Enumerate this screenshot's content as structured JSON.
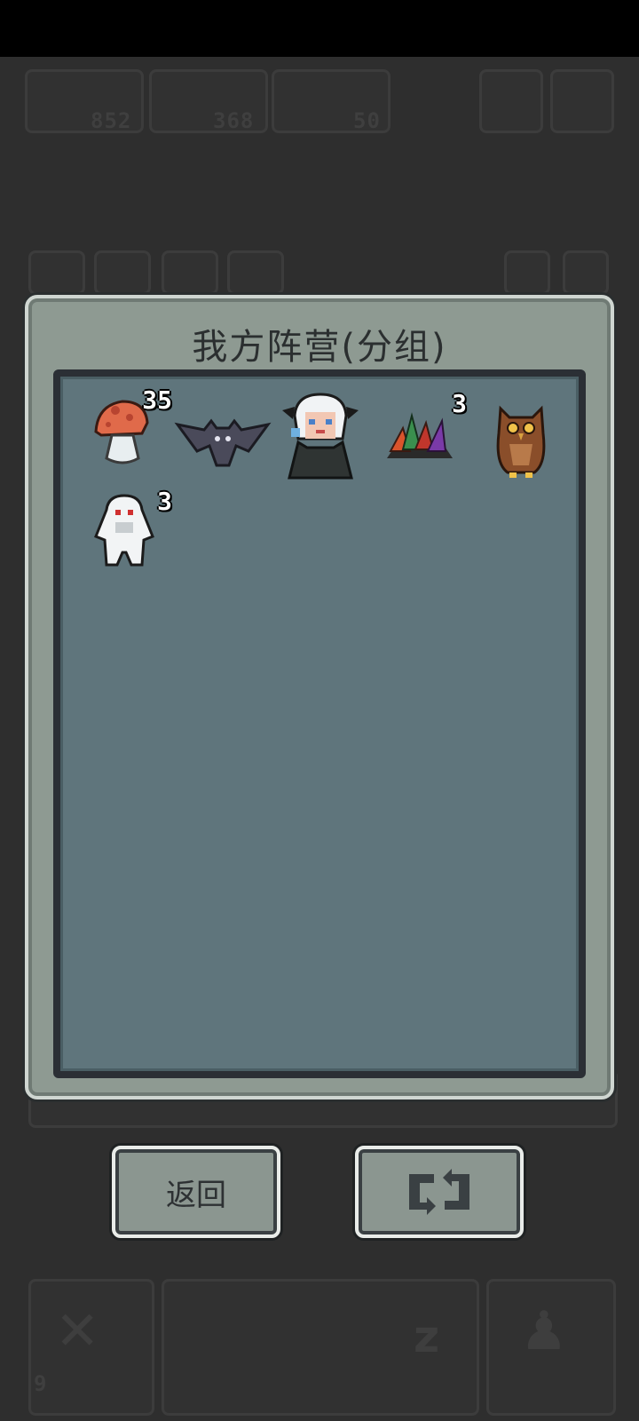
{
  "hud": {
    "resources": [
      "852",
      "368",
      "50"
    ],
    "bottom_count": "9"
  },
  "dialog": {
    "title": "我方阵营(分组)",
    "units": [
      {
        "name": "mushroom",
        "count": "35"
      },
      {
        "name": "bat",
        "count": ""
      },
      {
        "name": "white-haired-witch",
        "count": ""
      },
      {
        "name": "crystal-plant",
        "count": "3"
      },
      {
        "name": "owl",
        "count": ""
      },
      {
        "name": "white-ghost",
        "count": "3"
      }
    ]
  },
  "buttons": {
    "back_label": "返回",
    "refresh_icon": "refresh-icon"
  }
}
